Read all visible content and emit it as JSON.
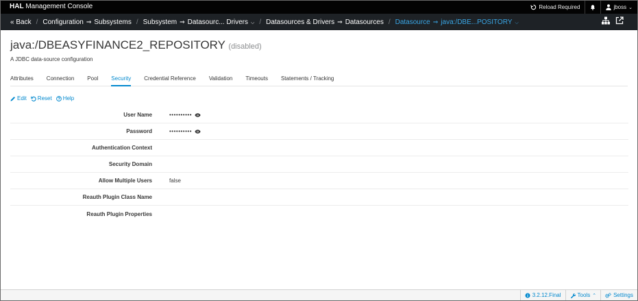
{
  "topbar": {
    "brand_bold": "HAL",
    "brand_rest": " Management Console",
    "reload": "Reload Required",
    "user": "jboss"
  },
  "breadcrumb": {
    "back": "« Back",
    "configuration": "Configuration",
    "subsystems": "Subsystems",
    "subsystem": "Subsystem",
    "datasourc_drivers": "Datasourc... Drivers",
    "ds_and_drivers": "Datasources & Drivers",
    "datasources": "Datasources",
    "datasource": "Datasource",
    "current": "java:/DBE...POSITORY"
  },
  "header": {
    "title": "java:/DBEASYFINANCE2_REPOSITORY",
    "disabled": "(disabled)",
    "subtitle": "A JDBC data-source configuration"
  },
  "tabs": [
    "Attributes",
    "Connection",
    "Pool",
    "Security",
    "Credential Reference",
    "Validation",
    "Timeouts",
    "Statements / Tracking"
  ],
  "active_tab": "Security",
  "actions": {
    "edit": "Edit",
    "reset": "Reset",
    "help": "Help"
  },
  "form": {
    "rows": [
      {
        "label": "User Name",
        "value": "••••••••••"
      },
      {
        "label": "Password",
        "value": "••••••••••"
      },
      {
        "label": "Authentication Context",
        "value": ""
      },
      {
        "label": "Security Domain",
        "value": ""
      },
      {
        "label": "Allow Multiple Users",
        "value": "false"
      },
      {
        "label": "Reauth Plugin Class Name",
        "value": ""
      },
      {
        "label": "Reauth Plugin Properties",
        "value": ""
      }
    ]
  },
  "footer": {
    "version": "3.2.12.Final",
    "tools": "Tools",
    "settings": "Settings"
  },
  "colors": {
    "topbar": "#030303",
    "crumbbar": "#1e2226",
    "accent": "#0088ce",
    "crumb_active": "#3aa8e8"
  }
}
